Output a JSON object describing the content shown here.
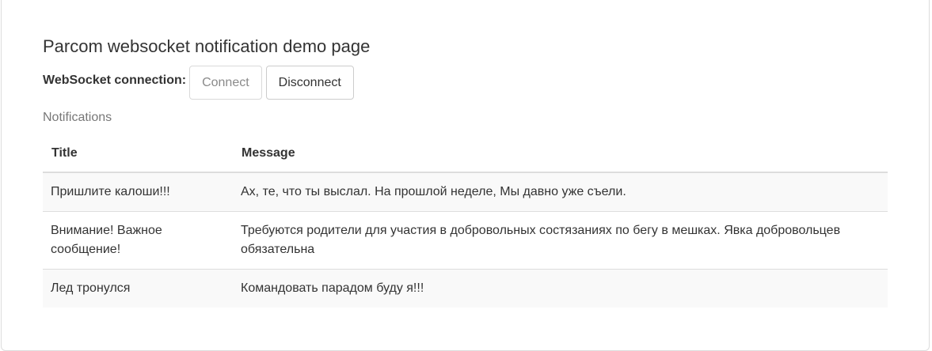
{
  "page": {
    "title": "Parcom websocket notification demo page"
  },
  "connection": {
    "label": "WebSocket connection:",
    "connect_label": "Connect",
    "disconnect_label": "Disconnect"
  },
  "notifications": {
    "caption": "Notifications",
    "columns": [
      "Title",
      "Message"
    ],
    "rows": [
      {
        "title": "Пришлите калоши!!!",
        "message": "Ах, те, что ты выслал. На прошлой неделе, Мы давно уже съели."
      },
      {
        "title": "Внимание! Важное сообщение!",
        "message": "Требуются родители для участия в добровольных состязаниях по бегу в мешках. Явка добровольцев обязательна"
      },
      {
        "title": "Лед тронулся",
        "message": "Командовать парадом буду я!!!"
      }
    ]
  }
}
